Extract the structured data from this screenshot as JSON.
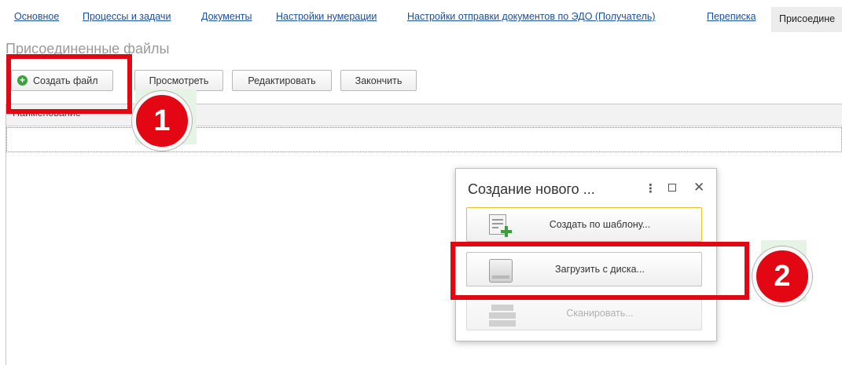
{
  "tabs": [
    {
      "label": "Основное"
    },
    {
      "label": "Процессы и задачи"
    },
    {
      "label": "Документы"
    },
    {
      "label": "Настройки нумерации"
    },
    {
      "label": "Настройки отправки документов по ЭДО (Получатель)"
    },
    {
      "label": "Переписка"
    },
    {
      "label": "Присоедине"
    }
  ],
  "page": {
    "title": "Присоединенные файлы"
  },
  "toolbar": {
    "create_label": "Создать файл",
    "view_label": "Просмотреть",
    "edit_label": "Редактировать",
    "finish_label": "Закончить"
  },
  "table": {
    "column_name": "Наименование"
  },
  "callouts": {
    "one": "1",
    "two": "2"
  },
  "dialog": {
    "title": "Создание нового ...",
    "kebab": "⋮",
    "close": "✕",
    "buttons": {
      "from_template": "Создать по шаблону...",
      "from_disk": "Загрузить с диска...",
      "scan": "Сканировать..."
    }
  },
  "colors": {
    "accent_red": "#e30613",
    "link_blue": "#1c4f9c",
    "plus_green": "#3aa13a"
  }
}
